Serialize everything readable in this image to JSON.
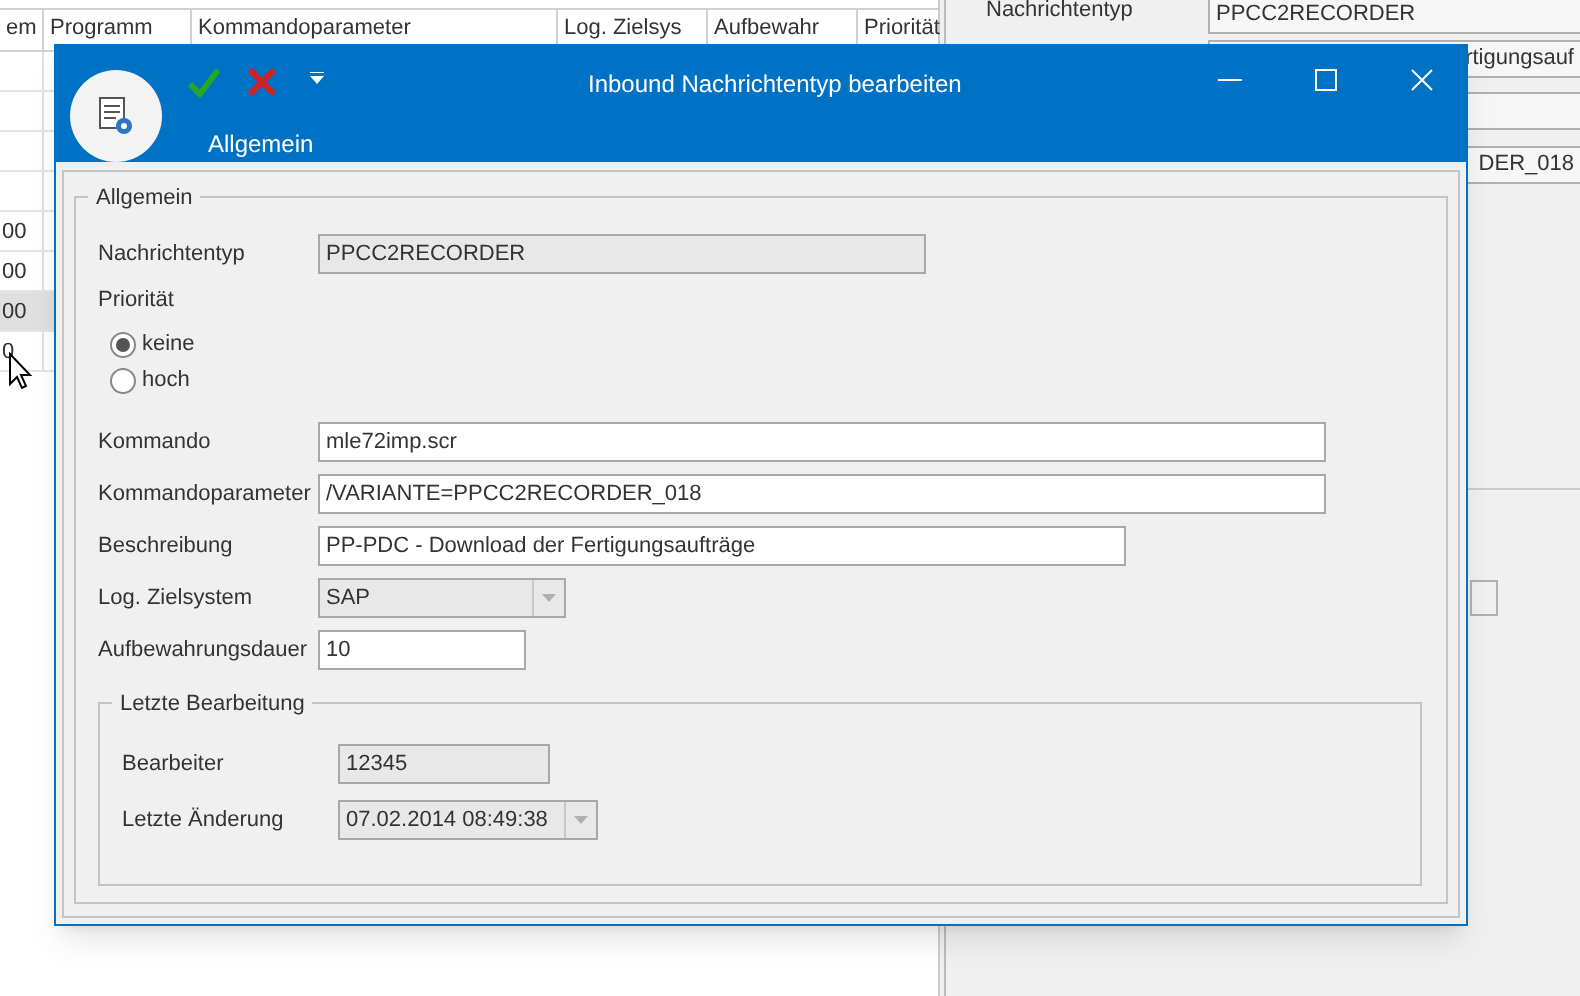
{
  "background_table": {
    "columns": [
      "em",
      "Programm",
      "Kommandoparameter",
      "Log. Zielsys",
      "Aufbewahr",
      "Priorität"
    ],
    "rows": [
      [
        ""
      ],
      [
        ""
      ],
      [
        ""
      ],
      [
        ""
      ],
      [
        "00"
      ],
      [
        "00"
      ],
      [
        "00"
      ],
      [
        "0"
      ]
    ]
  },
  "details_panel": {
    "label": "Nachrichtentyp",
    "fields": [
      {
        "value": "PPCC2RECORDER"
      },
      {
        "value": "rtigungsauf"
      },
      {
        "value": "DER_018"
      }
    ]
  },
  "dialog": {
    "title": "Inbound Nachrichtentyp bearbeiten",
    "ribbon_tab": "Allgemein",
    "group": "Allgemein",
    "fields": [
      {
        "kind": "readonly",
        "label": "Nachrichtentyp",
        "value": "PPCC2RECORDER"
      },
      {
        "kind": "radio",
        "label": "Priorität",
        "options": [
          {
            "label": "keine",
            "selected": true
          },
          {
            "label": "hoch",
            "selected": false
          }
        ]
      },
      {
        "kind": "text",
        "label": "Kommando",
        "value": "mle72imp.scr"
      },
      {
        "kind": "text",
        "label": "Kommandoparameter",
        "value": "/VARIANTE=PPCC2RECORDER_018"
      },
      {
        "kind": "text",
        "label": "Beschreibung",
        "value": "PP-PDC - Download der Fertigungsaufträge"
      },
      {
        "kind": "combo",
        "label": "Log. Zielsystem",
        "value": "SAP",
        "disabled": true
      },
      {
        "kind": "text",
        "label": "Aufbewahrungsdauer",
        "value": "10"
      }
    ],
    "subgroup": {
      "title": "Letzte Bearbeitung",
      "fields": [
        {
          "kind": "readonly",
          "label": "Bearbeiter",
          "value": "12345"
        },
        {
          "kind": "combo",
          "label": "Letzte Änderung",
          "value": "07.02.2014 08:49:38",
          "disabled": true
        }
      ]
    }
  }
}
